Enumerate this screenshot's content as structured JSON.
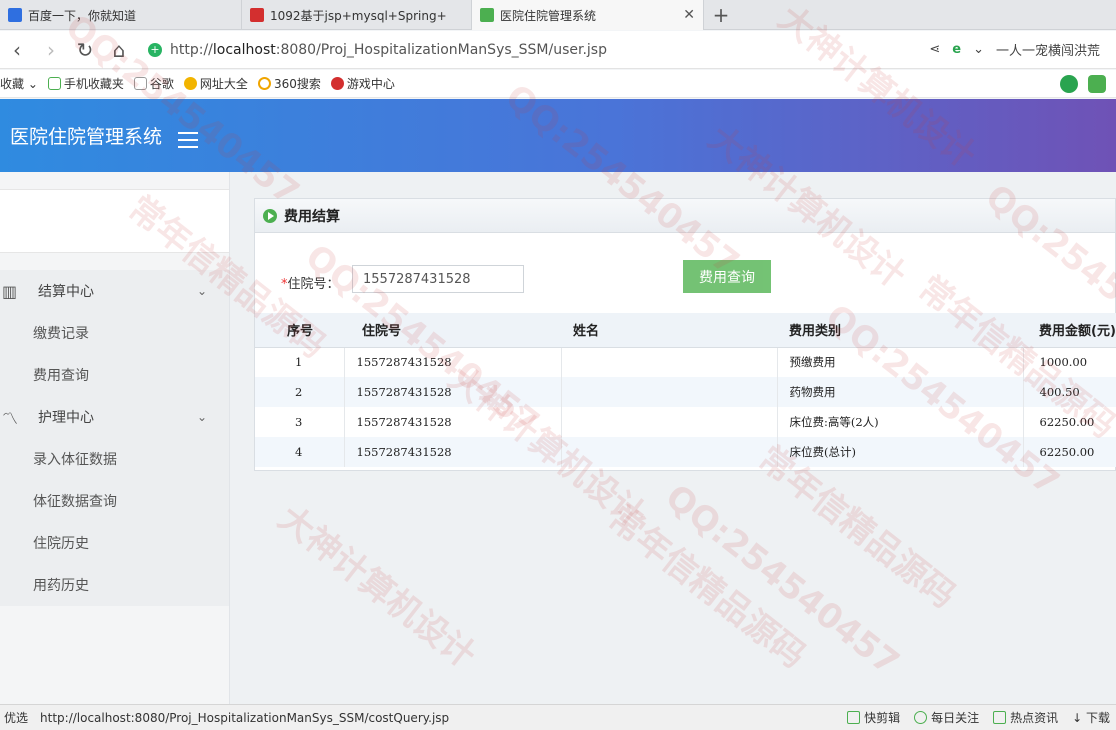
{
  "browser": {
    "tabs": [
      {
        "label": "百度一下，你就知道",
        "favicon_color": "#2f6fe0"
      },
      {
        "label": "1092基于jsp+mysql+Spring+",
        "favicon_color": "#d32f2f"
      },
      {
        "label": "医院住院管理系统",
        "favicon_color": "#4caf50",
        "active": true
      }
    ],
    "url_prefix": "http://",
    "url_host": "localhost",
    "url_rest": ":8080/Proj_HospitalizationManSys_SSM/user.jsp",
    "addr_right_text": "一人一宠横闯洪荒",
    "bookmarks": [
      "收藏",
      "手机收藏夹",
      "谷歌",
      "网址大全",
      "360搜索",
      "游戏中心"
    ]
  },
  "app": {
    "title": "医院住院管理系统"
  },
  "sidebar": {
    "groups": [
      {
        "label": "结算中心",
        "icon": "map-icon",
        "items": [
          "缴费记录",
          "费用查询"
        ]
      },
      {
        "label": "护理中心",
        "icon": "chart-line-icon",
        "items": [
          "录入体征数据",
          "体征数据查询",
          "住院历史",
          "用药历史"
        ]
      }
    ]
  },
  "panel": {
    "title": "费用结算",
    "query": {
      "required_mark": "*",
      "label": "住院号：",
      "value": "1557287431528",
      "button": "费用查询"
    },
    "table": {
      "headers": [
        "序号",
        "住院号",
        "姓名",
        "费用类别",
        "费用金额(元)"
      ],
      "rows": [
        [
          "1",
          "1557287431528",
          "",
          "预缴费用",
          "1000.00"
        ],
        [
          "2",
          "1557287431528",
          "",
          "药物费用",
          "400.50"
        ],
        [
          "3",
          "1557287431528",
          "",
          "床位费:高等(2人)",
          "62250.00"
        ],
        [
          "4",
          "1557287431528",
          "",
          "床位费(总计)",
          "62250.00"
        ]
      ]
    }
  },
  "statusbar": {
    "left": "优选",
    "url": "http://localhost:8080/Proj_HospitalizationManSys_SSM/costQuery.jsp",
    "right": [
      "快剪辑",
      "每日关注",
      "热点资讯",
      "下载"
    ]
  },
  "watermark": {
    "texts": [
      "QQ:254540457",
      "常年信精品源码",
      "大神计算机设计"
    ]
  }
}
